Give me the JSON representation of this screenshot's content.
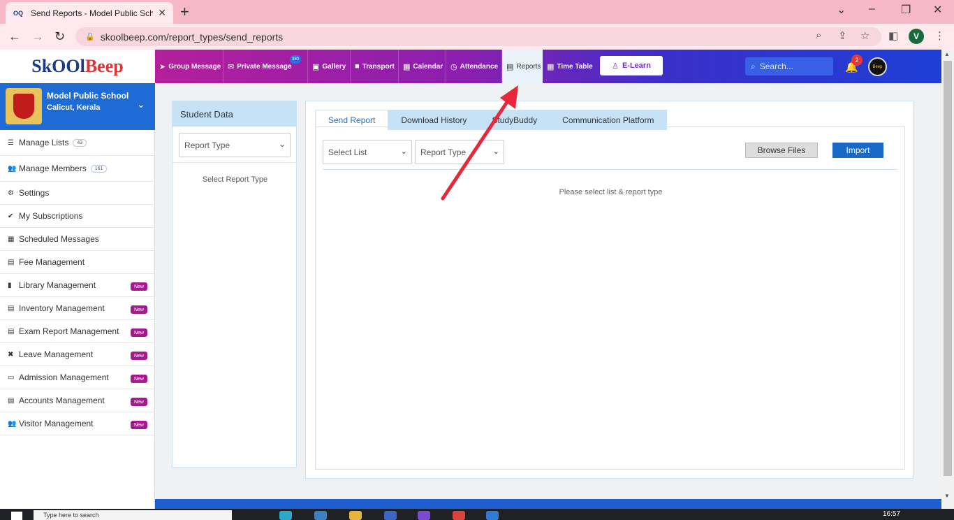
{
  "browser": {
    "tab_title": "Send Reports - Model Public School",
    "favicon": "OQ",
    "tab_close": "✕",
    "new_tab": "+",
    "url": "skoolbeep.com/report_types/send_reports",
    "profile_initial": "V",
    "controls": {
      "minimize": "–",
      "maximize": "❐",
      "close": "✕",
      "dropdown": "⌄"
    }
  },
  "app": {
    "logo": {
      "part1": "SkOOl",
      "part2": "Beep"
    },
    "nav": [
      {
        "label": "Group Message",
        "icon": "paper-plane-icon",
        "glyph": "➤"
      },
      {
        "label": "Private Message",
        "icon": "envelope-icon",
        "glyph": "✉",
        "badge": "380"
      },
      {
        "label": "Gallery",
        "icon": "image-icon",
        "glyph": "▣"
      },
      {
        "label": "Transport",
        "icon": "bus-icon",
        "glyph": "■"
      },
      {
        "label": "Calendar",
        "icon": "calendar-icon",
        "glyph": "▦"
      },
      {
        "label": "Attendance",
        "icon": "clock-icon",
        "glyph": "◷"
      },
      {
        "label": "Reports",
        "icon": "document-icon",
        "glyph": "▤"
      },
      {
        "label": "Time Table",
        "icon": "table-icon",
        "glyph": "▦"
      }
    ],
    "elearn_label": "E-Learn",
    "search_placeholder": "Search...",
    "notification_count": "2",
    "avatar_text": "Beep"
  },
  "sidebar": {
    "school_name": "Model Public School",
    "school_location": "Calicut, Kerala",
    "items": [
      {
        "label": "Manage Lists",
        "icon": "list-icon",
        "glyph": "☰",
        "count": "43"
      },
      {
        "label": "Manage Members",
        "icon": "users-icon",
        "glyph": "👥",
        "count": "161"
      },
      {
        "label": "Settings",
        "icon": "gear-icon",
        "glyph": "⚙"
      },
      {
        "label": "My Subscriptions",
        "icon": "check-icon",
        "glyph": "✔"
      },
      {
        "label": "Scheduled Messages",
        "icon": "calendar-icon",
        "glyph": "▦"
      },
      {
        "label": "Fee Management",
        "icon": "receipt-icon",
        "glyph": "▤"
      },
      {
        "label": "Library Management",
        "icon": "book-icon",
        "glyph": "▮",
        "new": "New"
      },
      {
        "label": "Inventory Management",
        "icon": "inventory-icon",
        "glyph": "▤",
        "new": "New"
      },
      {
        "label": "Exam Report Management",
        "icon": "file-icon",
        "glyph": "▤",
        "new": "New"
      },
      {
        "label": "Leave Management",
        "icon": "user-x-icon",
        "glyph": "✖",
        "new": "New"
      },
      {
        "label": "Admission Management",
        "icon": "id-card-icon",
        "glyph": "▭",
        "new": "New"
      },
      {
        "label": "Accounts Management",
        "icon": "ledger-icon",
        "glyph": "▤",
        "new": "New"
      },
      {
        "label": "Visitor Management",
        "icon": "users-icon",
        "glyph": "👥",
        "new": "New"
      }
    ]
  },
  "student_panel": {
    "title": "Student Data",
    "report_type_select": "Report Type",
    "message": "Select Report Type"
  },
  "report_panel": {
    "tabs": [
      "Send Report",
      "Download History",
      "StudyBuddy",
      "Communication Platform"
    ],
    "select_list": "Select List",
    "report_type": "Report Type",
    "browse_label": "Browse Files",
    "import_label": "Import",
    "message": "Please select list & report type"
  },
  "taskbar": {
    "search_text": "Type here to search",
    "time": "16:57"
  },
  "colors": {
    "nav_start": "#b41f9b",
    "nav_end": "#1d3fd6",
    "school_bar": "#1e6bd6",
    "new_badge": "#a51a8d",
    "import_btn": "#1969c8",
    "tab_bg": "#c5e2f7",
    "arrow": "#e8283a"
  }
}
